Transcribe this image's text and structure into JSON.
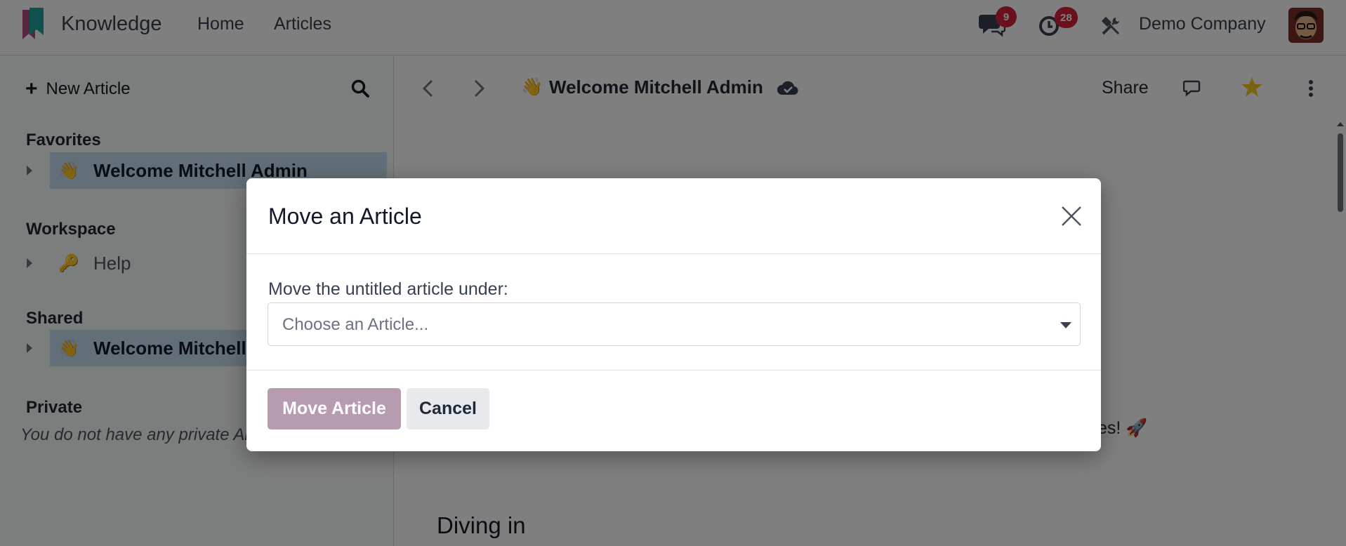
{
  "navbar": {
    "app_name": "Knowledge",
    "links": [
      "Home",
      "Articles"
    ],
    "messages_count": "9",
    "activities_count": "28",
    "company": "Demo Company"
  },
  "sidebar": {
    "new_article_label": "New Article",
    "sections": {
      "favorites": {
        "title": "Favorites",
        "items": [
          {
            "emoji": "👋",
            "label": "Welcome Mitchell Admin"
          }
        ]
      },
      "workspace": {
        "title": "Workspace",
        "items": [
          {
            "emoji": "🔑",
            "label": "Help"
          }
        ]
      },
      "shared": {
        "title": "Shared",
        "items": [
          {
            "emoji": "👋",
            "label": "Welcome Mitchell Admin"
          }
        ]
      },
      "private": {
        "title": "Private",
        "empty_message": "You do not have any private Articles."
      }
    }
  },
  "main": {
    "breadcrumb_emoji": "👋",
    "article_title": "Welcome Mitchell Admin",
    "share_label": "Share",
    "content_snippet": "es! 🚀",
    "heading": "Diving in"
  },
  "modal": {
    "title": "Move an Article",
    "field_label": "Move the untitled article under:",
    "select_placeholder": "Choose an Article...",
    "primary_button": "Move Article",
    "cancel_button": "Cancel"
  },
  "colors": {
    "primary_button": "#b79cb0",
    "badge": "#d6213b",
    "active_item": "#c7dff0",
    "star": "#f3c623"
  }
}
